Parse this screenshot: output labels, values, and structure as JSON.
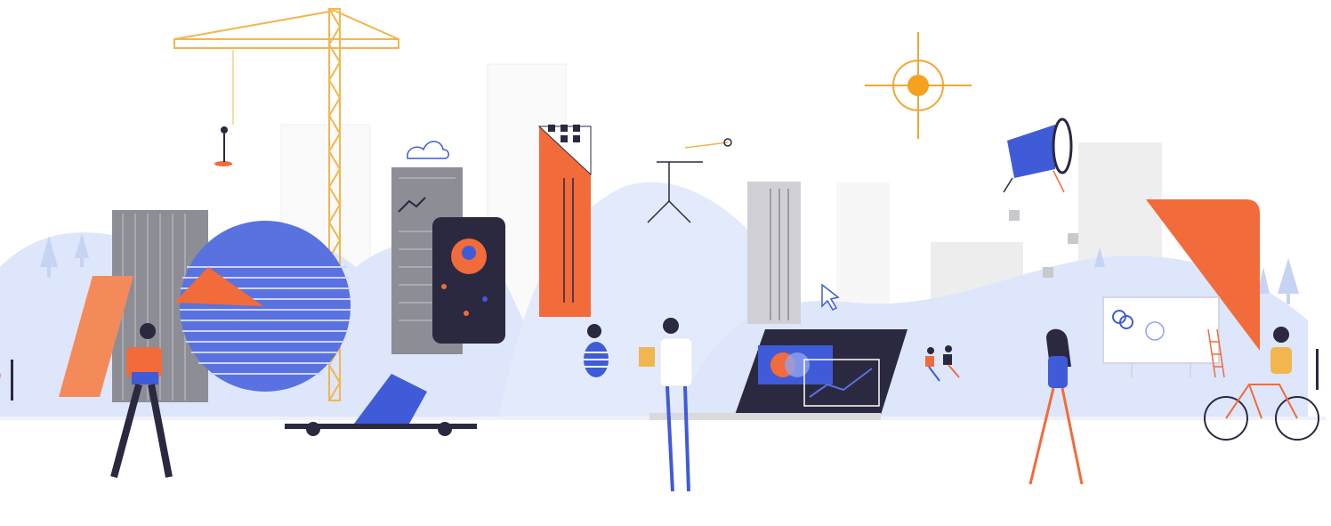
{
  "illustration": {
    "subject": "flat-illustration-cityscape-with-people",
    "colors": {
      "blue": "#3f5bd8",
      "light_blue": "#d9e3fb",
      "orange": "#f26b3a",
      "dark": "#2b2940",
      "grey": "#8d8d95",
      "gold": "#f0a832"
    },
    "icons": [
      "sun-icon",
      "cloud-icon",
      "cursor-icon",
      "crane-icon",
      "bicycle-icon",
      "tree-icon",
      "phone-icon",
      "laptop-icon",
      "spotlight-icon",
      "whiteboard-icon"
    ]
  }
}
